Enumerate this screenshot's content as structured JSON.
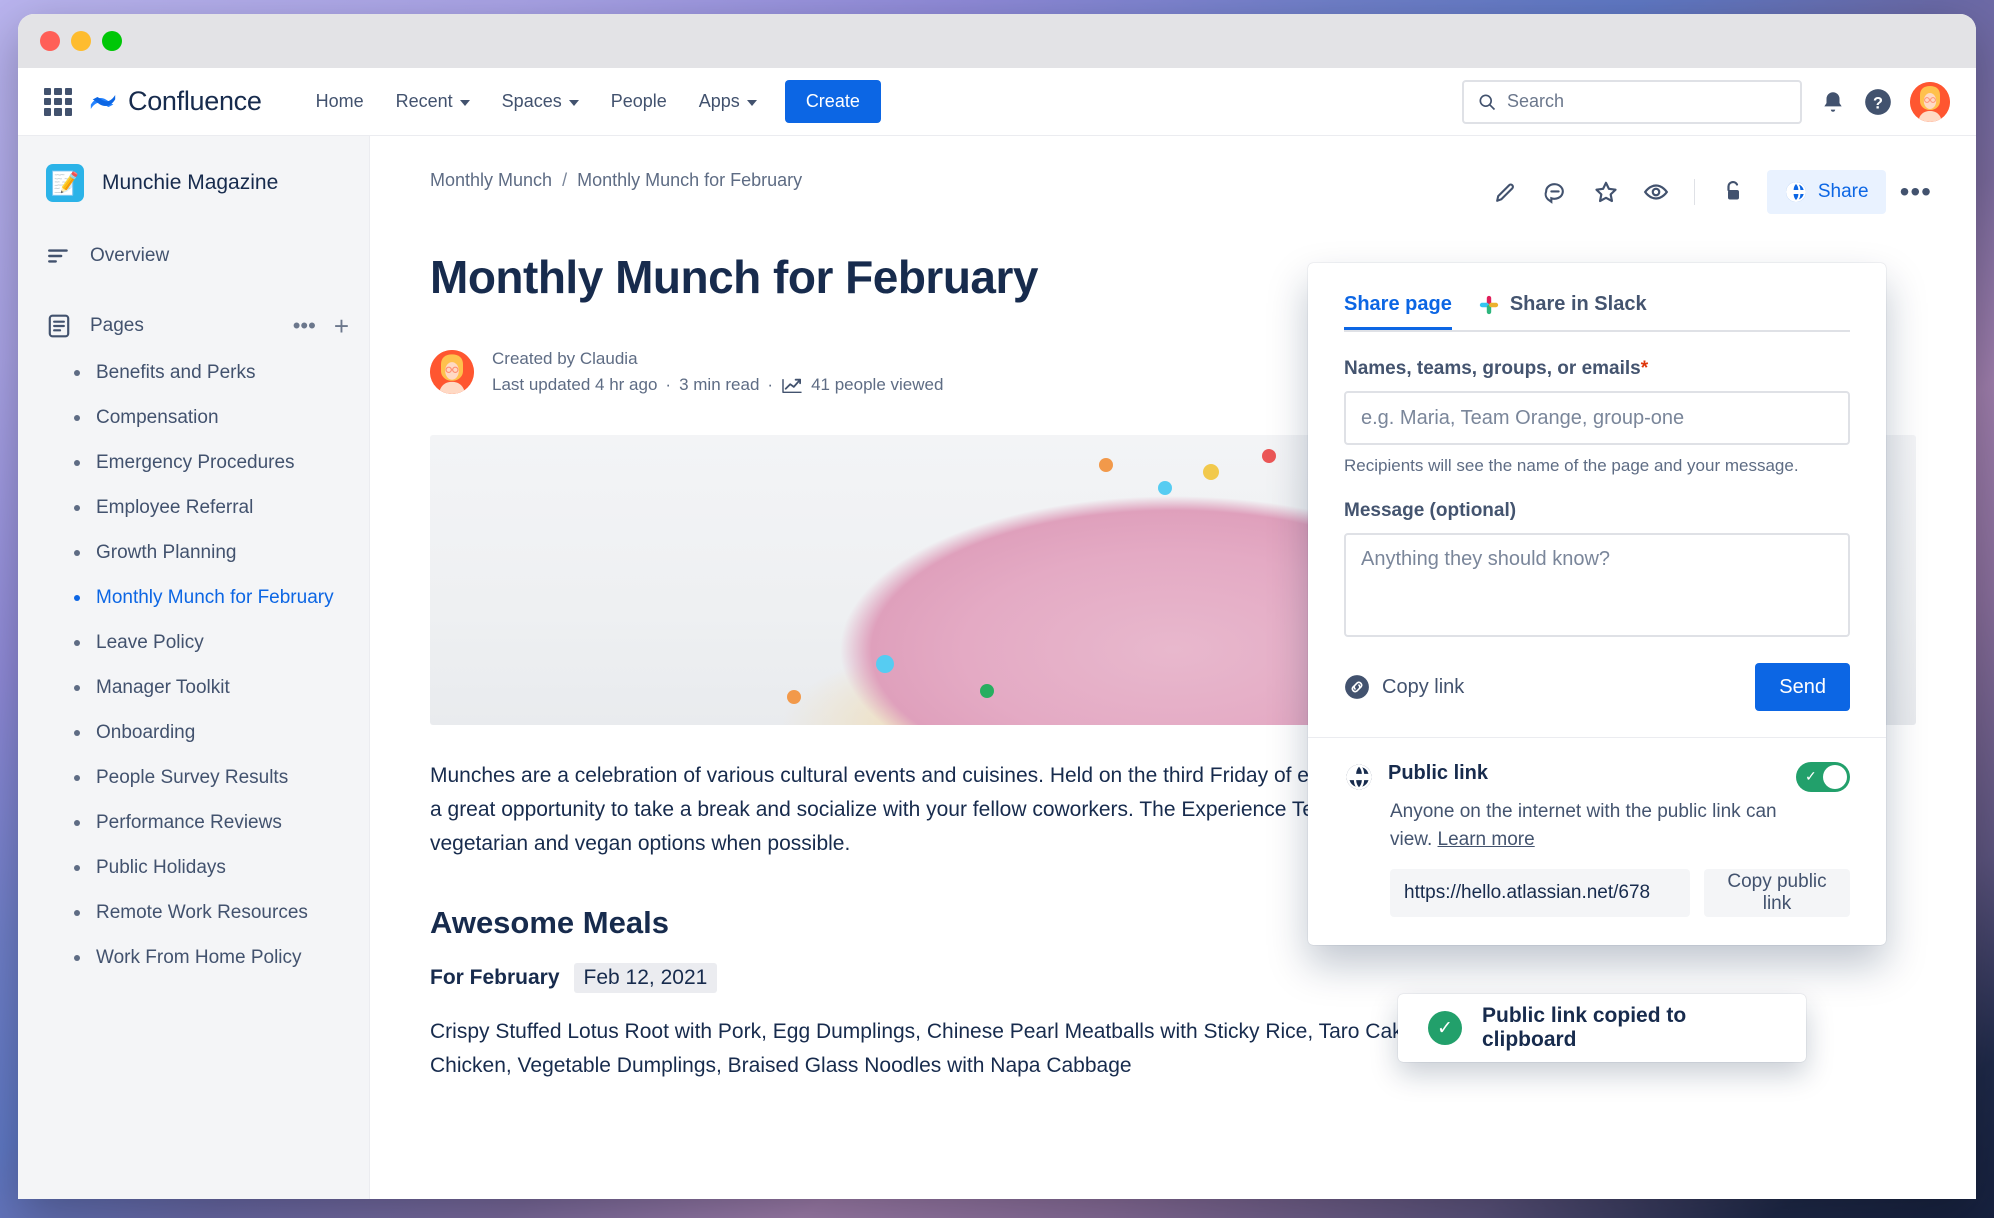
{
  "window": {
    "traffic_lights": [
      "close",
      "minimize",
      "maximize"
    ]
  },
  "topnav": {
    "app_switcher": "apps-grid-icon",
    "brand": "Confluence",
    "items": [
      {
        "label": "Home",
        "has_caret": false
      },
      {
        "label": "Recent",
        "has_caret": true
      },
      {
        "label": "Spaces",
        "has_caret": true
      },
      {
        "label": "People",
        "has_caret": false
      },
      {
        "label": "Apps",
        "has_caret": true
      }
    ],
    "create_label": "Create",
    "search_placeholder": "Search",
    "notifications_icon": "bell-icon",
    "help_icon": "help-icon",
    "avatar": "user-avatar"
  },
  "sidebar": {
    "space_name": "Munchie Magazine",
    "space_icon": "notebook-pencil-icon",
    "overview_label": "Overview",
    "pages_label": "Pages",
    "pages_more_icon": "more-options-icon",
    "pages_add_icon": "plus-icon",
    "pages": [
      "Benefits and Perks",
      "Compensation",
      "Emergency Procedures",
      "Employee Referral",
      "Growth Planning",
      "Monthly Munch for February",
      "Leave Policy",
      "Manager Toolkit",
      "Onboarding",
      "People Survey Results",
      "Performance Reviews",
      "Public Holidays",
      "Remote Work Resources",
      "Work From Home Policy"
    ],
    "active_page": "Monthly Munch for February"
  },
  "page": {
    "breadcrumb": {
      "parent": "Monthly Munch",
      "separator": "/",
      "current": "Monthly Munch for February"
    },
    "actions": [
      {
        "name": "edit-icon",
        "label": "Edit"
      },
      {
        "name": "comment-icon",
        "label": "Comment"
      },
      {
        "name": "star-icon",
        "label": "Star"
      },
      {
        "name": "watch-icon",
        "label": "Watch"
      },
      {
        "name": "restrictions-icon",
        "label": "Restrictions"
      }
    ],
    "share_label": "Share",
    "share_icon": "globe-icon",
    "more_label": "•••",
    "title": "Monthly Munch for February",
    "byline": {
      "created_by": "Created by Claudia",
      "last_updated": "Last updated 4 hr ago",
      "read_time": "3 min read",
      "views": "41 people viewed",
      "views_icon": "trend-chart-icon",
      "separator": "·"
    },
    "hero_alt": "cupcake-photo",
    "paragraph": "Munches are a celebration of various cultural events and cuisines. Held on the third Friday of every month, Munches are a great opportunity to take a break and socialize with your fellow coworkers. The Experience Team aims to offer vegetarian and vegan options when possible.",
    "meals_heading": "Awesome Meals",
    "meals_sub_label": "For February",
    "meals_date_chip": "Feb 12, 2021",
    "meals_body": "Crispy Stuffed Lotus Root with Pork, Egg Dumplings, Chinese Pearl Meatballs with Sticky Rice, Taro Cake, Soy Sauce Chicken, Vegetable Dumplings, Braised Glass Noodles with Napa Cabbage"
  },
  "share_dialog": {
    "tabs": [
      {
        "label": "Share page",
        "active": true,
        "icon": null
      },
      {
        "label": "Share in Slack",
        "active": false,
        "icon": "slack-icon"
      }
    ],
    "names_label": "Names, teams, groups, or emails",
    "names_required_mark": "*",
    "names_placeholder": "e.g. Maria, Team Orange, group-one",
    "names_hint": "Recipients will see the name of the page and your message.",
    "message_label": "Message (optional)",
    "message_placeholder": "Anything they should know?",
    "copy_link_label": "Copy link",
    "copy_link_icon": "link-icon",
    "send_label": "Send",
    "public_link": {
      "title": "Public link",
      "icon": "globe-icon",
      "toggle_on": true,
      "description": "Anyone on the internet with the public link can view.",
      "learn_more": "Learn more",
      "url": "https://hello.atlassian.net/678",
      "copy_label": "Copy public link"
    }
  },
  "toast": {
    "icon": "success-check-icon",
    "message": "Public link copied to clipboard"
  },
  "colors": {
    "brand_blue": "#0c66e4",
    "nav_text": "#42526e",
    "heading": "#172b4d",
    "success_green": "#22a06b",
    "required_red": "#de350b"
  }
}
